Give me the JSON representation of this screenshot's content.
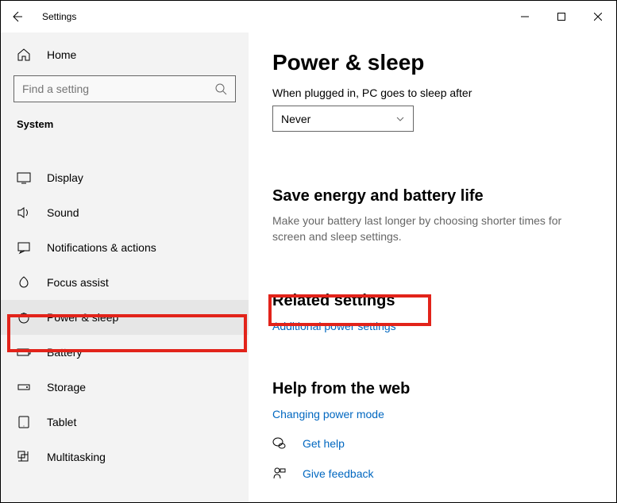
{
  "titlebar": {
    "title": "Settings"
  },
  "sidebar": {
    "home_label": "Home",
    "search_placeholder": "Find a setting",
    "section_label": "System",
    "items": [
      {
        "label": "Display"
      },
      {
        "label": "Sound"
      },
      {
        "label": "Notifications & actions"
      },
      {
        "label": "Focus assist"
      },
      {
        "label": "Power & sleep"
      },
      {
        "label": "Battery"
      },
      {
        "label": "Storage"
      },
      {
        "label": "Tablet"
      },
      {
        "label": "Multitasking"
      }
    ]
  },
  "main": {
    "title": "Power & sleep",
    "sleep_label": "When plugged in, PC goes to sleep after",
    "sleep_value": "Never",
    "energy_heading": "Save energy and battery life",
    "energy_desc": "Make your battery last longer by choosing shorter times for screen and sleep settings.",
    "related_heading": "Related settings",
    "related_link": "Additional power settings",
    "help_heading": "Help from the web",
    "help_link1": "Changing power mode",
    "get_help": "Get help",
    "give_feedback": "Give feedback"
  }
}
